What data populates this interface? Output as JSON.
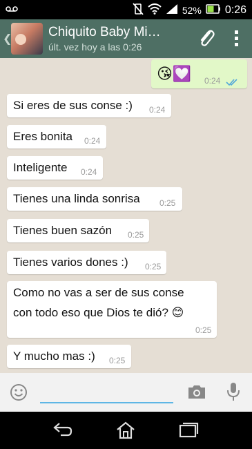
{
  "status": {
    "battery_pct": "52%",
    "time": "0:26"
  },
  "header": {
    "contact_name": "Chiquito Baby Mi…",
    "last_seen": "últ. vez hoy a las 0:26"
  },
  "messages": [
    {
      "dir": "out",
      "text": "😘💟",
      "time": "0:24"
    },
    {
      "dir": "in",
      "text": "Si eres de sus conse :)",
      "time": "0:24"
    },
    {
      "dir": "in",
      "text": "Eres bonita",
      "time": "0:24"
    },
    {
      "dir": "in",
      "text": "Inteligente",
      "time": "0:24"
    },
    {
      "dir": "in",
      "text": "Tienes una linda sonrisa",
      "time": "0:25"
    },
    {
      "dir": "in",
      "text": "Tienes buen sazón",
      "time": "0:25"
    },
    {
      "dir": "in",
      "text": "Tienes varios dones :)",
      "time": "0:25"
    },
    {
      "dir": "in",
      "text_line1": "Como no vas a ser de sus conse",
      "text_line2": "con todo eso que Dios te dió? 😊",
      "time": "0:25"
    },
    {
      "dir": "in",
      "text": "Y mucho mas :)",
      "time": "0:25"
    }
  ],
  "colors": {
    "header_bg": "#4e6f64",
    "chat_bg": "#e5ded4",
    "outgoing_bubble": "#e2f8c8",
    "input_underline": "#5eb6e5"
  }
}
